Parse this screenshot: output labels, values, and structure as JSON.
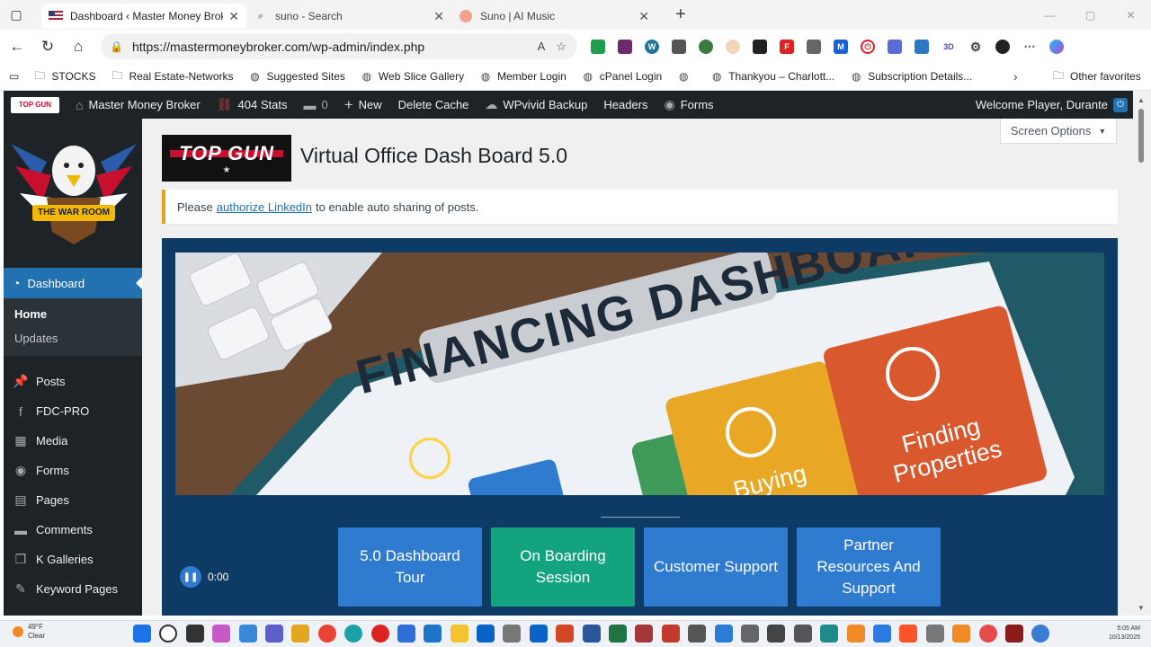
{
  "browser": {
    "tabs": [
      {
        "title": "Dashboard ‹ Master Money Broke",
        "active": true
      },
      {
        "title": "suno - Search",
        "active": false
      },
      {
        "title": "Suno | AI Music",
        "active": false
      }
    ],
    "url": "https://mastermoneybroker.com/wp-admin/index.php",
    "bookmarks": [
      "STOCKS",
      "Real Estate-Networks",
      "Suggested Sites",
      "Web Slice Gallery",
      "Member Login",
      "cPanel Login",
      "",
      "Thankyou – Charlott...",
      "Subscription Details..."
    ],
    "other_favorites": "Other favorites",
    "colors": {
      "accent": "#2271b1"
    }
  },
  "adminbar": {
    "site": "Master Money Broker",
    "stats": "404 Stats",
    "comments_count": "0",
    "new": "New",
    "delete_cache": "Delete Cache",
    "backup": "WPvivid Backup",
    "headers": "Headers",
    "forms": "Forms",
    "welcome": "Welcome Player, Durante"
  },
  "sidebar": {
    "active": "Dashboard",
    "submenu": [
      "Home",
      "Updates"
    ],
    "items": [
      {
        "label": "Posts",
        "icon": "pin-icon"
      },
      {
        "label": "FDC-PRO",
        "icon": "facebook-icon"
      },
      {
        "label": "Media",
        "icon": "media-icon"
      },
      {
        "label": "Forms",
        "icon": "forms-icon"
      },
      {
        "label": "Pages",
        "icon": "pages-icon"
      },
      {
        "label": "Comments",
        "icon": "comment-icon"
      },
      {
        "label": "K Galleries",
        "icon": "gallery-icon"
      },
      {
        "label": "Keyword Pages",
        "icon": "keyword-icon"
      }
    ],
    "logo_text": "THE WAR ROOM"
  },
  "main": {
    "screen_options": "Screen Options",
    "logo_text": "TOP GUN",
    "title": "Virtual Office Dash Board 5.0",
    "notice": {
      "before": "Please",
      "link": "authorize LinkedIn",
      "after": "to enable auto sharing of posts."
    },
    "banner": {
      "headline": "FINANCING DASHBOARD",
      "card_right": "Finding Properties",
      "card_mid": "Buying"
    },
    "buttons": [
      "5.0 Dashboard Tour",
      "On Boarding Session",
      "Customer Support",
      "Partner Resources And Support"
    ],
    "audio_time": "0:00"
  },
  "taskbar": {
    "weather_temp": "49°F",
    "weather_desc": "Clear",
    "time": "5:05 AM",
    "date": "10/13/2025"
  }
}
